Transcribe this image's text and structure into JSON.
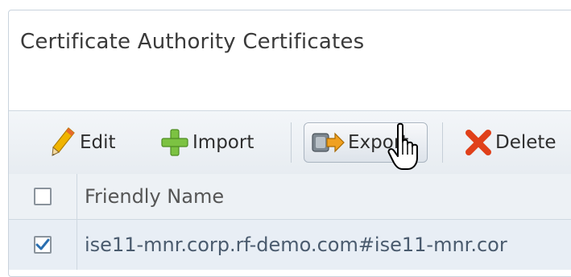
{
  "page": {
    "title": "Certificate Authority Certificates"
  },
  "toolbar": {
    "edit_label": "Edit",
    "import_label": "Import",
    "export_label": "Export",
    "delete_label": "Delete"
  },
  "icons": {
    "edit": "pencil-icon",
    "import": "plus-icon",
    "export": "export-icon",
    "delete": "delete-x-icon",
    "cursor": "hand-cursor-icon"
  },
  "colors": {
    "pencil": "#f0b400",
    "import_plus": "#7cc242",
    "delete_x": "#e0401a",
    "check": "#2a6fb0"
  },
  "table": {
    "columns": [
      "Friendly Name"
    ],
    "rows": [
      {
        "checked": true,
        "friendly_name": "ise11-mnr.corp.rf-demo.com#ise11-mnr.cor"
      }
    ]
  }
}
